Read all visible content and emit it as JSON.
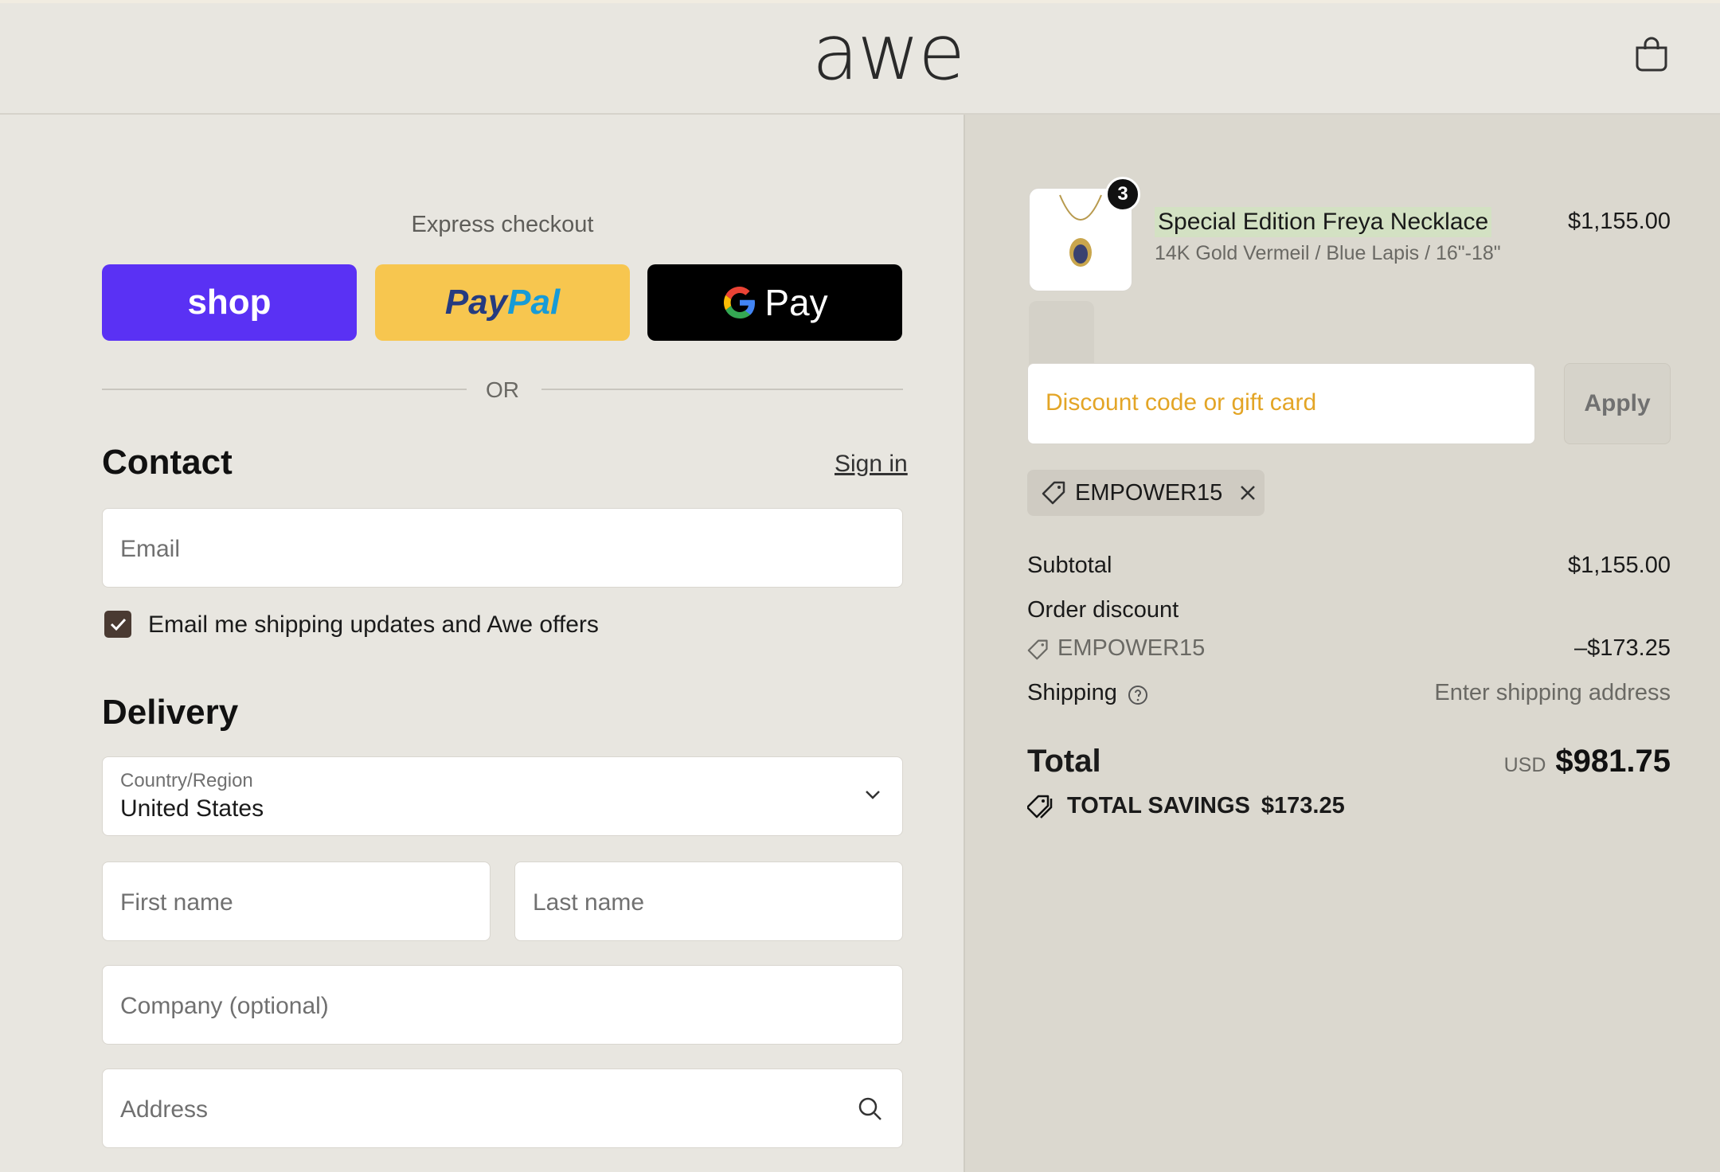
{
  "header": {
    "logo": "awe",
    "cart_icon": "shopping-bag-icon"
  },
  "express": {
    "title": "Express checkout",
    "shop_label": "shop",
    "paypal_label_1": "Pay",
    "paypal_label_2": "Pal",
    "gpay_label": "Pay",
    "or_label": "OR"
  },
  "contact": {
    "title": "Contact",
    "signin_label": "Sign in",
    "email_placeholder": "Email",
    "marketing_label": "Email me shipping updates and Awe offers",
    "marketing_checked": true
  },
  "delivery": {
    "title": "Delivery",
    "country_label": "Country/Region",
    "country_value": "United States",
    "first_name_placeholder": "First name",
    "last_name_placeholder": "Last name",
    "company_placeholder": "Company (optional)",
    "address_placeholder": "Address"
  },
  "order": {
    "item": {
      "quantity": "3",
      "name": "Special Edition Freya Necklace",
      "variant": "14K Gold Vermeil / Blue Lapis / 16\"-18\"",
      "price": "$1,155.00"
    },
    "discount_placeholder": "Discount code or gift card",
    "apply_label": "Apply",
    "applied_code": "EMPOWER15",
    "subtotal_label": "Subtotal",
    "subtotal_value": "$1,155.00",
    "order_discount_label": "Order discount",
    "discount_code": "EMPOWER15",
    "discount_value": "–$173.25",
    "shipping_label": "Shipping",
    "shipping_value": "Enter shipping address",
    "total_label": "Total",
    "currency": "USD",
    "total_value": "$981.75",
    "savings_label": "TOTAL SAVINGS",
    "savings_value": "$173.25"
  },
  "colors": {
    "shop_purple": "#5a31f4",
    "paypal_yellow": "#f7c64f",
    "discount_placeholder": "#e3a526"
  }
}
